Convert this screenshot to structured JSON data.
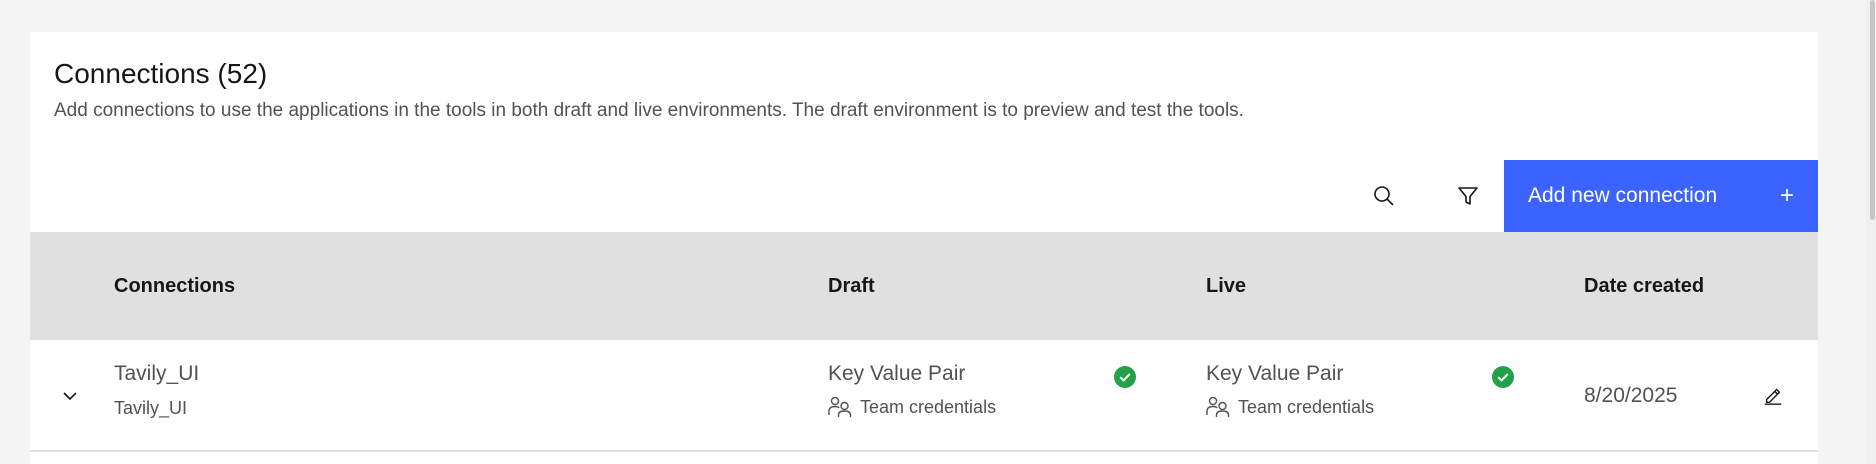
{
  "header": {
    "title": "Connections (52)",
    "subtitle": "Add connections to use the applications in the tools in both draft and live environments. The draft environment is to preview and test the tools."
  },
  "toolbar": {
    "search_icon": "search-icon",
    "filter_icon": "filter-icon",
    "add_label": "Add new connection",
    "add_icon": "+",
    "accent_color": "#3b63ff"
  },
  "table": {
    "columns": [
      "Connections",
      "Draft",
      "Live",
      "Date created"
    ],
    "rows": [
      {
        "name": "Tavily_UI",
        "id": "Tavily_UI",
        "draft_type": "Key Value Pair",
        "draft_credentials": "Team credentials",
        "draft_status": "success",
        "live_type": "Key Value Pair",
        "live_credentials": "Team credentials",
        "live_status": "success",
        "date_created": "8/20/2025"
      }
    ]
  },
  "colors": {
    "success": "#24a148",
    "header_bg": "#e0e0e0"
  }
}
